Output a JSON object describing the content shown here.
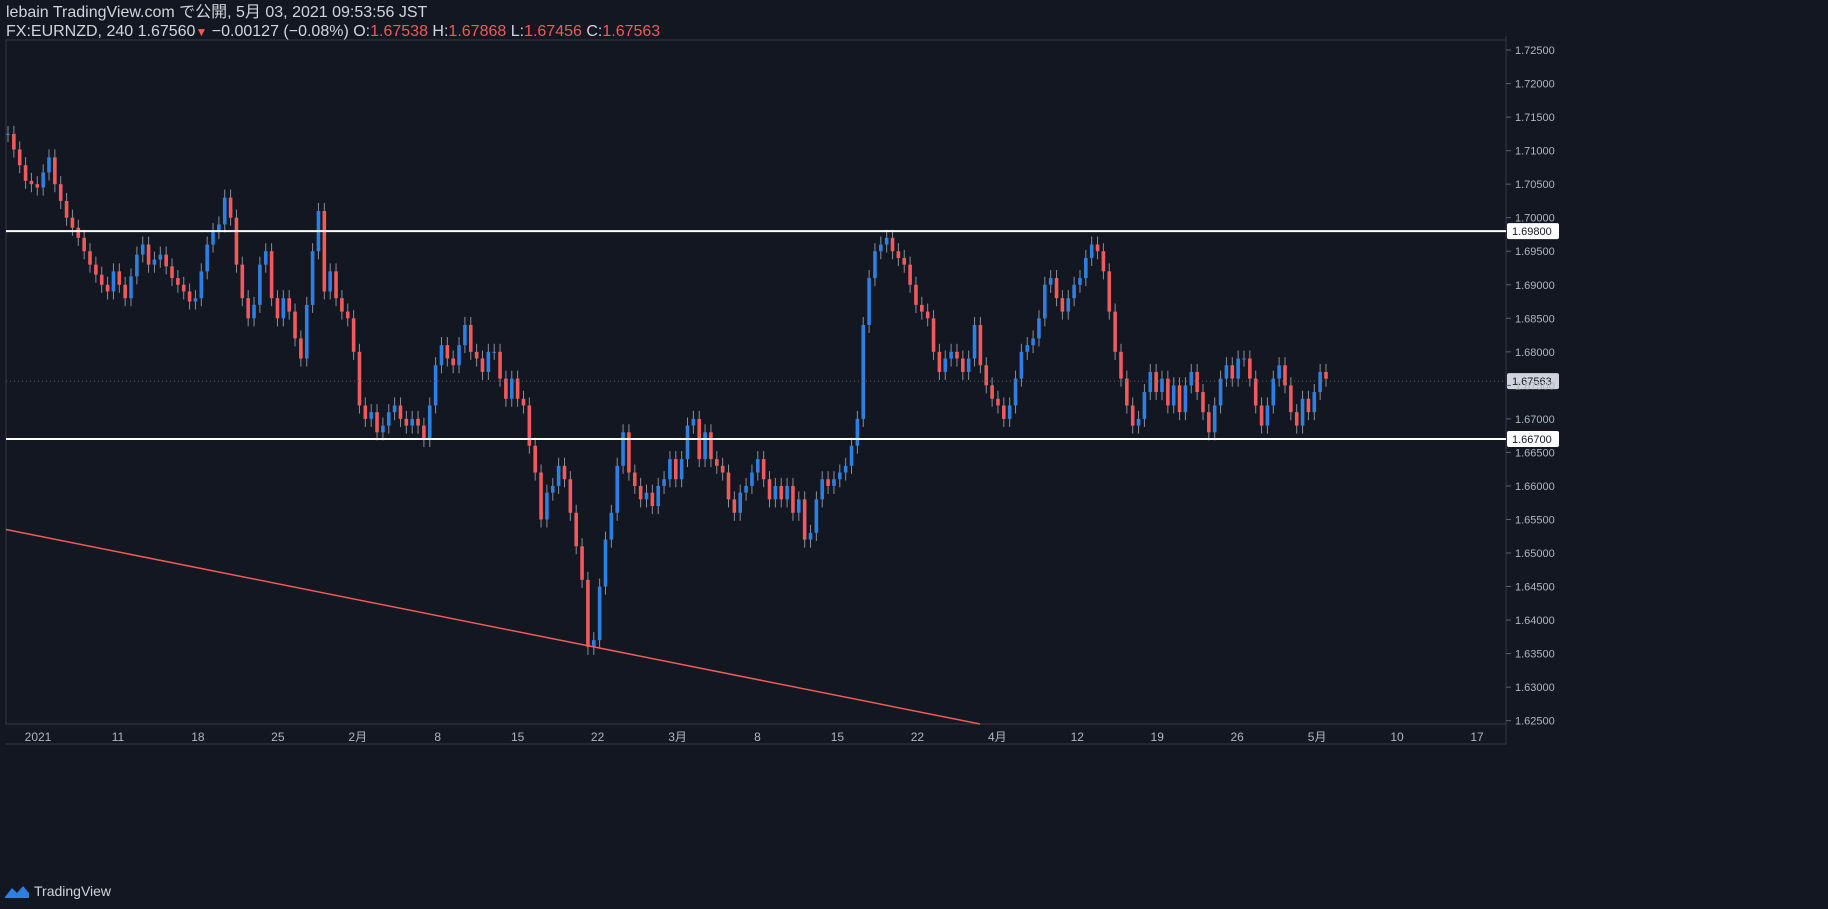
{
  "header": {
    "publisher_line": "lebain TradingView.com で公開, 5月 03, 2021 09:53:56 JST",
    "symbol": "FX:EURNZD, 240",
    "last": "1.67560",
    "change": "−0.00127 (−0.08%)",
    "o_label": "O:",
    "o_value": "1.67538",
    "h_label": "H:",
    "h_value": "1.67868",
    "l_label": "L:",
    "l_value": "1.67456",
    "c_label": "C:",
    "c_value": "1.67563"
  },
  "footer": {
    "brand": "TradingView"
  },
  "colors": {
    "up": "#2d7fe0",
    "down": "#f05a5a",
    "background": "#131722",
    "level_line": "#ffffff",
    "trend_line": "#f05a5a"
  },
  "chart_data": {
    "type": "candlestick",
    "symbol": "FX:EURNZD",
    "interval": "240",
    "y_axis": {
      "ylim": [
        1.6245,
        1.7265
      ],
      "ticks": [
        "1.62500",
        "1.63000",
        "1.63500",
        "1.64000",
        "1.64500",
        "1.65000",
        "1.65500",
        "1.66000",
        "1.66500",
        "1.67000",
        "1.67500",
        "1.68000",
        "1.68500",
        "1.69000",
        "1.69500",
        "1.70000",
        "1.70500",
        "1.71000",
        "1.71500",
        "1.72000",
        "1.72500"
      ]
    },
    "x_axis": {
      "ticks": [
        "2021",
        "11",
        "18",
        "25",
        "2月",
        "8",
        "15",
        "22",
        "3月",
        "8",
        "15",
        "22",
        "4月",
        "12",
        "19",
        "26",
        "5月",
        "10",
        "17"
      ]
    },
    "horizontal_levels": [
      {
        "price": 1.698,
        "label": "1.69800"
      },
      {
        "price": 1.667,
        "label": "1.66700"
      }
    ],
    "current_price": {
      "price": 1.67563,
      "label": "1.67563"
    },
    "trend_line": {
      "from": 1.6535,
      "to": 1.6245
    },
    "close_path": [
      [
        0,
        1.7125
      ],
      [
        3,
        1.7055
      ],
      [
        5,
        1.7045
      ],
      [
        7,
        1.709
      ],
      [
        8,
        1.705
      ],
      [
        10,
        1.7
      ],
      [
        12,
        1.697
      ],
      [
        14,
        1.693
      ],
      [
        16,
        1.69
      ],
      [
        17,
        1.689
      ],
      [
        18,
        1.692
      ],
      [
        20,
        1.688
      ],
      [
        22,
        1.6945
      ],
      [
        23,
        1.696
      ],
      [
        24,
        1.693
      ],
      [
        26,
        1.6945
      ],
      [
        28,
        1.691
      ],
      [
        30,
        1.689
      ],
      [
        31,
        1.6875
      ],
      [
        32,
        1.688
      ],
      [
        33,
        1.692
      ],
      [
        34,
        1.696
      ],
      [
        35,
        1.698
      ],
      [
        36,
        1.699
      ],
      [
        37,
        1.703
      ],
      [
        38,
        1.7
      ],
      [
        39,
        1.693
      ],
      [
        40,
        1.688
      ],
      [
        41,
        1.685
      ],
      [
        42,
        1.687
      ],
      [
        43,
        1.693
      ],
      [
        44,
        1.695
      ],
      [
        45,
        1.688
      ],
      [
        46,
        1.685
      ],
      [
        47,
        1.688
      ],
      [
        48,
        1.686
      ],
      [
        49,
        1.682
      ],
      [
        50,
        1.679
      ],
      [
        51,
        1.687
      ],
      [
        52,
        1.695
      ],
      [
        53,
        1.701
      ],
      [
        54,
        1.689
      ],
      [
        55,
        1.692
      ],
      [
        56,
        1.688
      ],
      [
        57,
        1.686
      ],
      [
        58,
        1.685
      ],
      [
        59,
        1.68
      ],
      [
        60,
        1.672
      ],
      [
        61,
        1.67
      ],
      [
        62,
        1.671
      ],
      [
        63,
        1.668
      ],
      [
        64,
        1.669
      ],
      [
        65,
        1.671
      ],
      [
        66,
        1.672
      ],
      [
        67,
        1.67
      ],
      [
        68,
        1.669
      ],
      [
        69,
        1.67
      ],
      [
        70,
        1.669
      ],
      [
        71,
        1.667
      ],
      [
        72,
        1.672
      ],
      [
        73,
        1.678
      ],
      [
        74,
        1.681
      ],
      [
        75,
        1.679
      ],
      [
        76,
        1.678
      ],
      [
        77,
        1.681
      ],
      [
        78,
        1.684
      ],
      [
        79,
        1.68
      ],
      [
        80,
        1.679
      ],
      [
        81,
        1.677
      ],
      [
        82,
        1.68
      ],
      [
        83,
        1.68
      ],
      [
        84,
        1.676
      ],
      [
        85,
        1.673
      ],
      [
        86,
        1.676
      ],
      [
        87,
        1.673
      ],
      [
        88,
        1.672
      ],
      [
        89,
        1.666
      ],
      [
        90,
        1.662
      ],
      [
        91,
        1.655
      ],
      [
        92,
        1.659
      ],
      [
        93,
        1.66
      ],
      [
        94,
        1.663
      ],
      [
        95,
        1.661
      ],
      [
        96,
        1.656
      ],
      [
        97,
        1.651
      ],
      [
        98,
        1.646
      ],
      [
        99,
        1.636
      ],
      [
        100,
        1.637
      ],
      [
        101,
        1.645
      ],
      [
        102,
        1.652
      ],
      [
        103,
        1.656
      ],
      [
        104,
        1.663
      ],
      [
        105,
        1.668
      ],
      [
        106,
        1.662
      ],
      [
        107,
        1.66
      ],
      [
        108,
        1.658
      ],
      [
        109,
        1.659
      ],
      [
        110,
        1.657
      ],
      [
        111,
        1.66
      ],
      [
        112,
        1.661
      ],
      [
        113,
        1.664
      ],
      [
        114,
        1.661
      ],
      [
        115,
        1.664
      ],
      [
        116,
        1.669
      ],
      [
        117,
        1.67
      ],
      [
        118,
        1.664
      ],
      [
        119,
        1.668
      ],
      [
        120,
        1.664
      ],
      [
        121,
        1.663
      ],
      [
        122,
        1.662
      ],
      [
        123,
        1.658
      ],
      [
        124,
        1.656
      ],
      [
        125,
        1.659
      ],
      [
        126,
        1.66
      ],
      [
        127,
        1.662
      ],
      [
        128,
        1.664
      ],
      [
        129,
        1.661
      ],
      [
        130,
        1.658
      ],
      [
        131,
        1.66
      ],
      [
        132,
        1.658
      ],
      [
        133,
        1.66
      ],
      [
        134,
        1.656
      ],
      [
        135,
        1.658
      ],
      [
        136,
        1.652
      ],
      [
        137,
        1.653
      ],
      [
        138,
        1.658
      ],
      [
        139,
        1.661
      ],
      [
        140,
        1.66
      ],
      [
        141,
        1.661
      ],
      [
        142,
        1.662
      ],
      [
        143,
        1.663
      ],
      [
        144,
        1.666
      ],
      [
        145,
        1.67
      ],
      [
        146,
        1.684
      ],
      [
        147,
        1.691
      ],
      [
        148,
        1.695
      ],
      [
        149,
        1.696
      ],
      [
        150,
        1.697
      ],
      [
        151,
        1.695
      ],
      [
        152,
        1.694
      ],
      [
        153,
        1.693
      ],
      [
        154,
        1.69
      ],
      [
        155,
        1.687
      ],
      [
        156,
        1.686
      ],
      [
        157,
        1.685
      ],
      [
        158,
        1.68
      ],
      [
        159,
        1.677
      ],
      [
        160,
        1.679
      ],
      [
        161,
        1.68
      ],
      [
        162,
        1.679
      ],
      [
        163,
        1.677
      ],
      [
        164,
        1.679
      ],
      [
        165,
        1.684
      ],
      [
        166,
        1.678
      ],
      [
        167,
        1.675
      ],
      [
        168,
        1.673
      ],
      [
        169,
        1.672
      ],
      [
        170,
        1.67
      ],
      [
        171,
        1.672
      ],
      [
        172,
        1.676
      ],
      [
        173,
        1.68
      ],
      [
        174,
        1.681
      ],
      [
        175,
        1.682
      ],
      [
        176,
        1.685
      ],
      [
        177,
        1.69
      ],
      [
        178,
        1.691
      ],
      [
        179,
        1.688
      ],
      [
        180,
        1.686
      ],
      [
        181,
        1.688
      ],
      [
        182,
        1.69
      ],
      [
        183,
        1.691
      ],
      [
        184,
        1.694
      ],
      [
        185,
        1.696
      ],
      [
        186,
        1.695
      ],
      [
        187,
        1.692
      ],
      [
        188,
        1.686
      ],
      [
        189,
        1.68
      ],
      [
        190,
        1.676
      ],
      [
        191,
        1.672
      ],
      [
        192,
        1.669
      ],
      [
        193,
        1.67
      ],
      [
        194,
        1.674
      ],
      [
        195,
        1.677
      ],
      [
        196,
        1.674
      ],
      [
        197,
        1.676
      ],
      [
        198,
        1.672
      ],
      [
        199,
        1.675
      ],
      [
        200,
        1.671
      ],
      [
        201,
        1.675
      ],
      [
        202,
        1.677
      ],
      [
        203,
        1.674
      ],
      [
        204,
        1.671
      ],
      [
        205,
        1.668
      ],
      [
        206,
        1.672
      ],
      [
        207,
        1.676
      ],
      [
        208,
        1.678
      ],
      [
        209,
        1.676
      ],
      [
        210,
        1.679
      ],
      [
        211,
        1.679
      ],
      [
        212,
        1.676
      ],
      [
        213,
        1.672
      ],
      [
        214,
        1.669
      ],
      [
        215,
        1.672
      ],
      [
        216,
        1.676
      ],
      [
        217,
        1.678
      ],
      [
        218,
        1.675
      ],
      [
        219,
        1.671
      ],
      [
        220,
        1.669
      ],
      [
        221,
        1.673
      ],
      [
        222,
        1.671
      ],
      [
        223,
        1.674
      ],
      [
        224,
        1.677
      ],
      [
        225,
        1.676
      ]
    ]
  }
}
